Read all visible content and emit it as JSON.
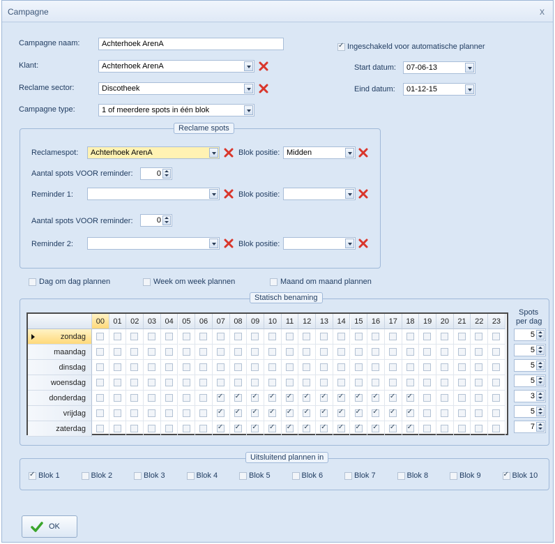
{
  "window": {
    "title": "Campagne",
    "close_glyph": "x"
  },
  "form": {
    "campagne_naam_label": "Campagne naam:",
    "campagne_naam_value": "Achterhoek ArenA",
    "klant_label": "Klant:",
    "klant_value": "Achterhoek ArenA",
    "sector_label": "Reclame sector:",
    "sector_value": "Discotheek",
    "type_label": "Campagne type:",
    "type_value": "1 of meerdere spots in één blok",
    "auto_planner_label": "Ingeschakeld voor automatische planner",
    "auto_planner_checked": true,
    "start_label": "Start datum:",
    "start_value": "07-06-13",
    "eind_label": "Eind datum:",
    "eind_value": "01-12-15"
  },
  "spots": {
    "caption": "Reclame spots",
    "reclamespot_label": "Reclamespot:",
    "reclamespot_value": "Achterhoek ArenA",
    "blok_positie_label": "Blok positie:",
    "blok_positie_value": "Midden",
    "aantal1_label": "Aantal spots VOOR reminder:",
    "aantal1_value": "0",
    "reminder1_label": "Reminder 1:",
    "reminder1_value": "",
    "blok_positie2_label": "Blok positie:",
    "blok_positie2_value": "",
    "aantal2_label": "Aantal spots VOOR reminder:",
    "aantal2_value": "0",
    "reminder2_label": "Reminder 2:",
    "reminder2_value": "",
    "blok_positie3_label": "Blok positie:",
    "blok_positie3_value": ""
  },
  "planning": {
    "dag_label": "Dag om dag plannen",
    "week_label": "Week om week plannen",
    "maand_label": "Maand om maand plannen"
  },
  "schedule": {
    "caption": "Statisch benaming",
    "spots_header": "Spots",
    "per_dag_header": "per dag",
    "hours": [
      "00",
      "01",
      "02",
      "03",
      "04",
      "05",
      "06",
      "07",
      "08",
      "09",
      "10",
      "11",
      "12",
      "13",
      "14",
      "15",
      "16",
      "17",
      "18",
      "19",
      "20",
      "21",
      "22",
      "23"
    ],
    "rows": [
      {
        "day": "zondag",
        "checked": [],
        "spots": "5"
      },
      {
        "day": "maandag",
        "checked": [],
        "spots": "5"
      },
      {
        "day": "dinsdag",
        "checked": [],
        "spots": "5"
      },
      {
        "day": "woensdag",
        "checked": [],
        "spots": "5"
      },
      {
        "day": "donderdag",
        "checked": [
          7,
          8,
          9,
          10,
          11,
          12,
          13,
          14,
          15,
          16,
          17,
          18
        ],
        "spots": "3"
      },
      {
        "day": "vrijdag",
        "checked": [
          7,
          8,
          9,
          10,
          11,
          12,
          13,
          14,
          15,
          16,
          17,
          18
        ],
        "spots": "5"
      },
      {
        "day": "zaterdag",
        "checked": [
          7,
          8,
          9,
          10,
          11,
          12,
          13,
          14,
          15,
          16,
          17,
          18
        ],
        "spots": "7"
      }
    ]
  },
  "blocks": {
    "caption": "Uitsluitend plannen in",
    "items": [
      {
        "label": "Blok 1",
        "checked": true
      },
      {
        "label": "Blok 2",
        "checked": false
      },
      {
        "label": "Blok 3",
        "checked": false
      },
      {
        "label": "Blok 4",
        "checked": false
      },
      {
        "label": "Blok 5",
        "checked": false
      },
      {
        "label": "Blok 6",
        "checked": false
      },
      {
        "label": "Blok 7",
        "checked": false
      },
      {
        "label": "Blok 8",
        "checked": false
      },
      {
        "label": "Blok 9",
        "checked": false
      },
      {
        "label": "Blok 10",
        "checked": true
      }
    ]
  },
  "ok_label": "OK",
  "colors": {
    "accent": "#ffd97a",
    "frame": "#dbe7f5",
    "remove_icon": "#d9362b",
    "ok_check": "#3aa52b"
  }
}
